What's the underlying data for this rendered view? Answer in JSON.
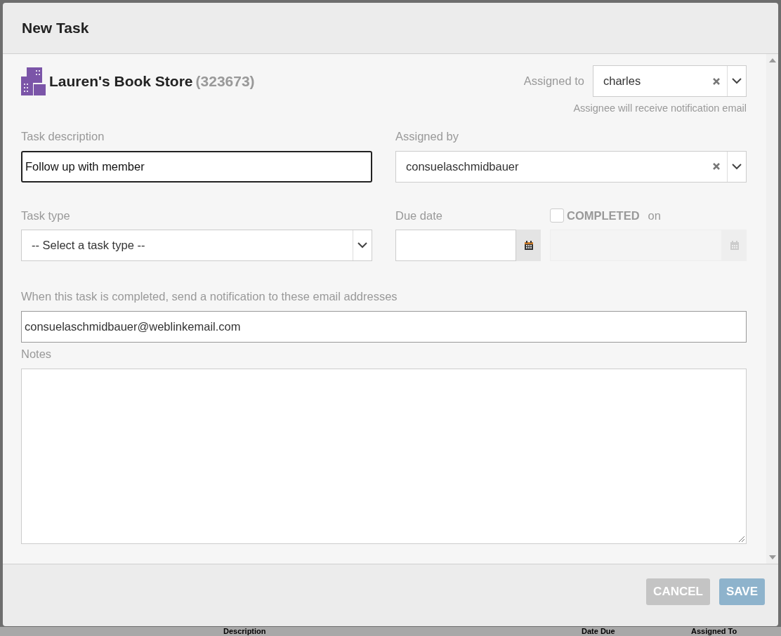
{
  "dialog": {
    "title": "New Task"
  },
  "member": {
    "name": "Lauren's Book Store",
    "id": "(323673)"
  },
  "assigned_to": {
    "label": "Assigned to",
    "value": "charles",
    "hint": "Assignee will receive notification email"
  },
  "task_description": {
    "label": "Task description",
    "value": "Follow up with member",
    "focused": true
  },
  "assigned_by": {
    "label": "Assigned by",
    "value": "consuelaschmidbauer"
  },
  "task_type": {
    "label": "Task type",
    "value": "-- Select a task type --"
  },
  "due_date": {
    "label": "Due date"
  },
  "completed": {
    "label": "COMPLETED",
    "suffix": "on",
    "checked": false
  },
  "notify": {
    "label": "When this task is completed, send a notification to these email addresses",
    "value": "consuelaschmidbauer@weblinkemail.com"
  },
  "notes": {
    "label": "Notes"
  },
  "buttons": [
    {
      "label": "CANCEL",
      "kind": "cancel"
    },
    {
      "label": "SAVE",
      "kind": "save"
    }
  ],
  "background_table": {
    "columns": [
      "Description",
      "Date Due",
      "Assigned To"
    ]
  }
}
